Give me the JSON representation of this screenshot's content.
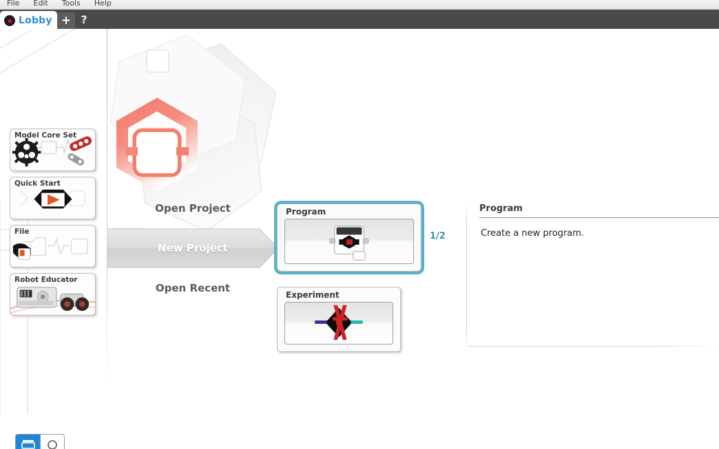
{
  "menubar": {
    "items": [
      {
        "label": "File"
      },
      {
        "label": "Edit"
      },
      {
        "label": "Tools"
      },
      {
        "label": "Help"
      }
    ]
  },
  "tabbar": {
    "lobby_tab": {
      "label": "Lobby",
      "icon": "ev3-brick-icon"
    },
    "new_tab_label": "+",
    "help_label": "?"
  },
  "sidebar": {
    "cards": [
      {
        "title": "Model Core Set",
        "icon": "gear-and-beam-icon"
      },
      {
        "title": "Quick Start",
        "icon": "play-triangle-icon"
      },
      {
        "title": "File",
        "icon": "file-hand-icon"
      },
      {
        "title": "Robot Educator",
        "icon": "robot-brick-icon"
      }
    ]
  },
  "navigation": {
    "items": [
      {
        "label": "Open Project",
        "selected": false
      },
      {
        "label": "New Project",
        "selected": true
      },
      {
        "label": "Open Recent",
        "selected": false
      }
    ]
  },
  "project_types": {
    "pagination": "1/2",
    "cards": [
      {
        "title": "Program",
        "icon": "ev3-brick-thumb",
        "selected": true
      },
      {
        "title": "Experiment",
        "icon": "experiment-cross-thumb",
        "selected": false
      }
    ]
  },
  "detail_panel": {
    "title": "Program",
    "description": "Create a new program."
  },
  "bottom_toolbar": {
    "buttons": [
      {
        "name": "list-view-button",
        "icon": "list-icon",
        "active": true
      },
      {
        "name": "search-button",
        "icon": "magnifier-icon",
        "active": false
      }
    ]
  },
  "colors": {
    "accent_teal": "#57b3cc",
    "tab_blue": "#2e8fd4",
    "brand_coral": "#f4897b",
    "tabbar_dark": "#4a4a4a",
    "toolbar_blue": "#1e87d8"
  }
}
